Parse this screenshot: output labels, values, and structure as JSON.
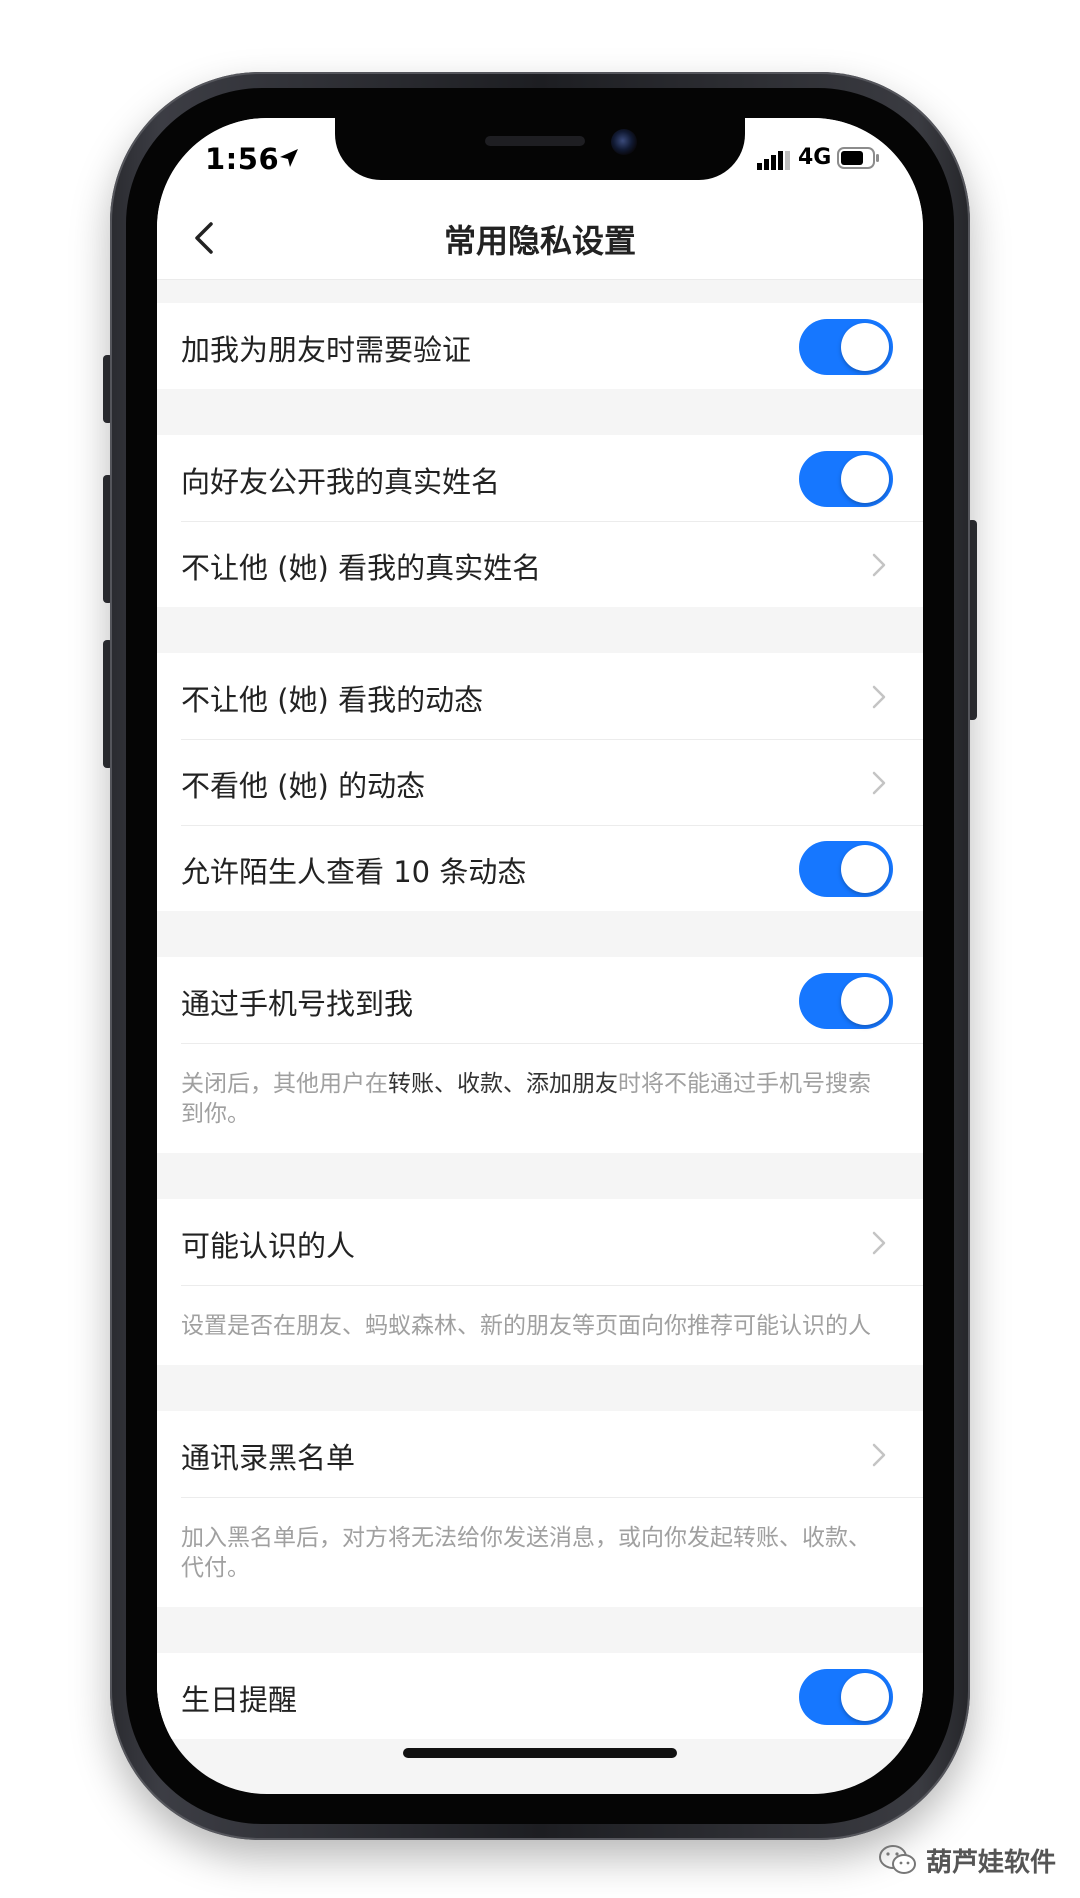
{
  "status_bar": {
    "time": "1:56",
    "network": "4G"
  },
  "nav": {
    "title": "常用隐私设置"
  },
  "sections": {
    "friend_verify": {
      "label": "加我为朋友时需要验证",
      "toggle": true
    },
    "public_real_name": {
      "label": "向好友公开我的真实姓名",
      "toggle": true
    },
    "hide_real_name": {
      "label": "不让他 (她) 看我的真实姓名"
    },
    "hide_my_moments": {
      "label": "不让他 (她) 看我的动态"
    },
    "not_see_moments": {
      "label": "不看他 (她) 的动态"
    },
    "stranger_moments": {
      "label": "允许陌生人查看 10 条动态",
      "toggle": true
    },
    "find_by_phone": {
      "label": "通过手机号找到我",
      "toggle": true,
      "desc_prefix": "关闭后，其他用户在",
      "desc_highlight": "转账、收款、添加朋友",
      "desc_suffix": "时将不能通过手机号搜索到你。"
    },
    "people_you_may_know": {
      "label": "可能认识的人",
      "desc": "设置是否在朋友、蚂蚁森林、新的朋友等页面向你推荐可能认识的人"
    },
    "contacts_blacklist": {
      "label": "通讯录黑名单",
      "desc": "加入黑名单后，对方将无法给你发送消息，或向你发起转账、收款、代付。"
    },
    "birthday_reminder": {
      "label": "生日提醒",
      "toggle": true
    }
  },
  "watermark": {
    "text": "葫芦娃软件"
  },
  "colors": {
    "accent": "#1677ff",
    "background": "#f5f5f5",
    "hint_text": "#a0a0a0"
  },
  "icons": [
    "location-arrow-icon",
    "signal-icon",
    "battery-icon",
    "back-arrow-icon",
    "chevron-right-icon",
    "wechat-icon"
  ]
}
